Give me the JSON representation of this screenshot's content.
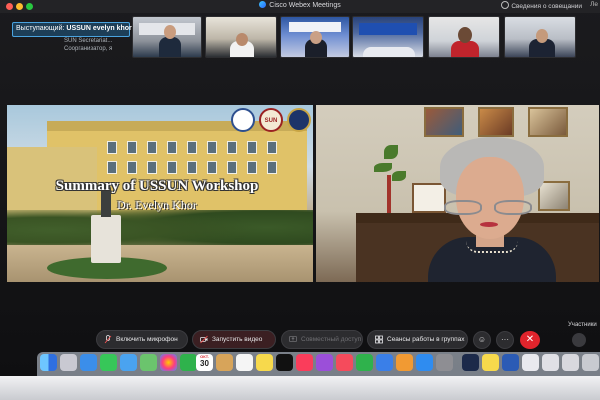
{
  "window": {
    "title": "Cisco Webex Meetings",
    "meeting_info": "Сведения о совещании",
    "right_truncated": "Ле"
  },
  "speaker": {
    "label_prefix": "Выступающий:",
    "name": "USSUN evelyn khor",
    "subtitle_line1": "SUN Secretariat...",
    "subtitle_line2": "Соорганизатор, я"
  },
  "presentation": {
    "title": "Summary of USSUN Workshop",
    "author": "Dr. Evelyn Khor",
    "emblems": [
      "university-emblem",
      "SUN",
      "association-emblem"
    ],
    "emblem_text": "SUN"
  },
  "controls": {
    "mic_label": "Включить микрофон",
    "video_label": "Запустить видео",
    "share_label": "Совместный доступ",
    "breakout_label": "Сеансы работы в группах",
    "participants_label": "Участники"
  },
  "dock": {
    "calendar_month": "ОКТ.",
    "calendar_day": "30",
    "apps": [
      "finder",
      "launchpad",
      "safari",
      "messages",
      "mail",
      "maps",
      "photos",
      "facetime",
      "calendar",
      "contacts",
      "reminders",
      "notes",
      "tv",
      "music",
      "podcasts",
      "news",
      "numbers",
      "keynote",
      "pages",
      "appstore",
      "system-preferences",
      "webex",
      "notes-yellow",
      "word",
      "doc1",
      "doc2",
      "doc3",
      "trash"
    ]
  },
  "colors": {
    "accent": "#4aa3df",
    "end_call": "#e0242c",
    "video_off": "#3b1f22"
  }
}
